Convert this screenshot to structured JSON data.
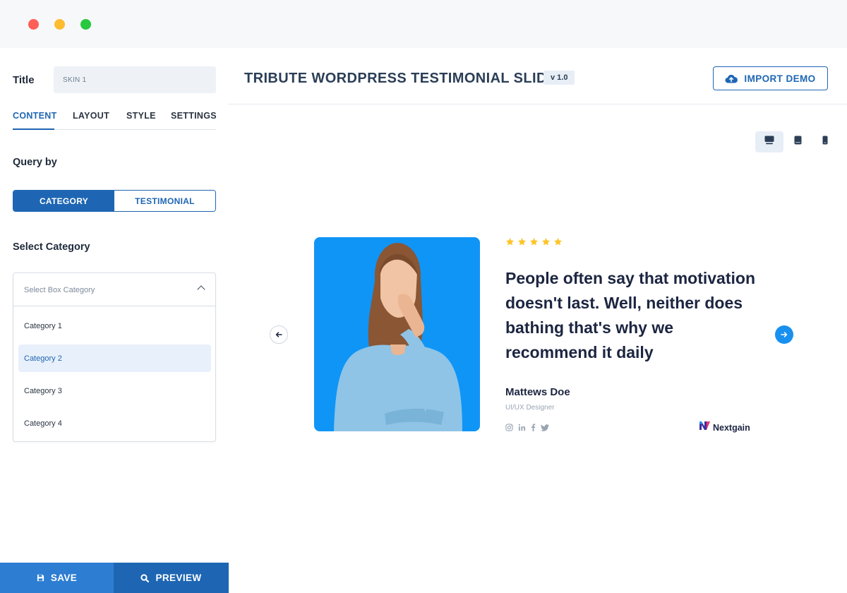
{
  "window": {
    "controls": [
      "close",
      "minimize",
      "maximize"
    ]
  },
  "sidebar": {
    "title_label": "Title",
    "title_value": "SKIN 1",
    "tabs": [
      {
        "label": "CONTENT",
        "active": true
      },
      {
        "label": "LAYOUT",
        "active": false
      },
      {
        "label": "STYLE",
        "active": false
      },
      {
        "label": "SETTINGS",
        "active": false
      }
    ],
    "query_label": "Query by",
    "query_options": [
      {
        "label": "CATEGORY",
        "selected": true
      },
      {
        "label": "TESTIMONIAL",
        "selected": false
      }
    ],
    "select_category_label": "Select Category",
    "dropdown": {
      "placeholder": "Select Box Category",
      "options": [
        "Category 1",
        "Category 2",
        "Category 3",
        "Category 4"
      ],
      "highlighted": "Category 2"
    },
    "save_label": "SAVE",
    "preview_label": "PREVIEW"
  },
  "header": {
    "title": "TRIBUTE WORDPRESS TESTIMONIAL SLIDER",
    "version": "v 1.0",
    "import_label": "IMPORT DEMO"
  },
  "devices": [
    {
      "name": "desktop-icon",
      "active": true
    },
    {
      "name": "tablet-icon",
      "active": false
    },
    {
      "name": "mobile-icon",
      "active": false
    }
  ],
  "testimonial": {
    "rating": 5,
    "quote": "People often say that motivation doesn't last. Well, neither does bathing that's why we recommend it daily",
    "author": "Mattews Doe",
    "role": "UI/UX Designer",
    "socials": [
      "instagram-icon",
      "linkedin-icon",
      "facebook-icon",
      "twitter-icon"
    ],
    "brand": "Nextgain"
  },
  "colors": {
    "primary": "#1e66b3",
    "accent_blue": "#1890f0",
    "photo_bg": "#0f95f6",
    "star": "#fdc52b",
    "heading": "#1c2541"
  }
}
